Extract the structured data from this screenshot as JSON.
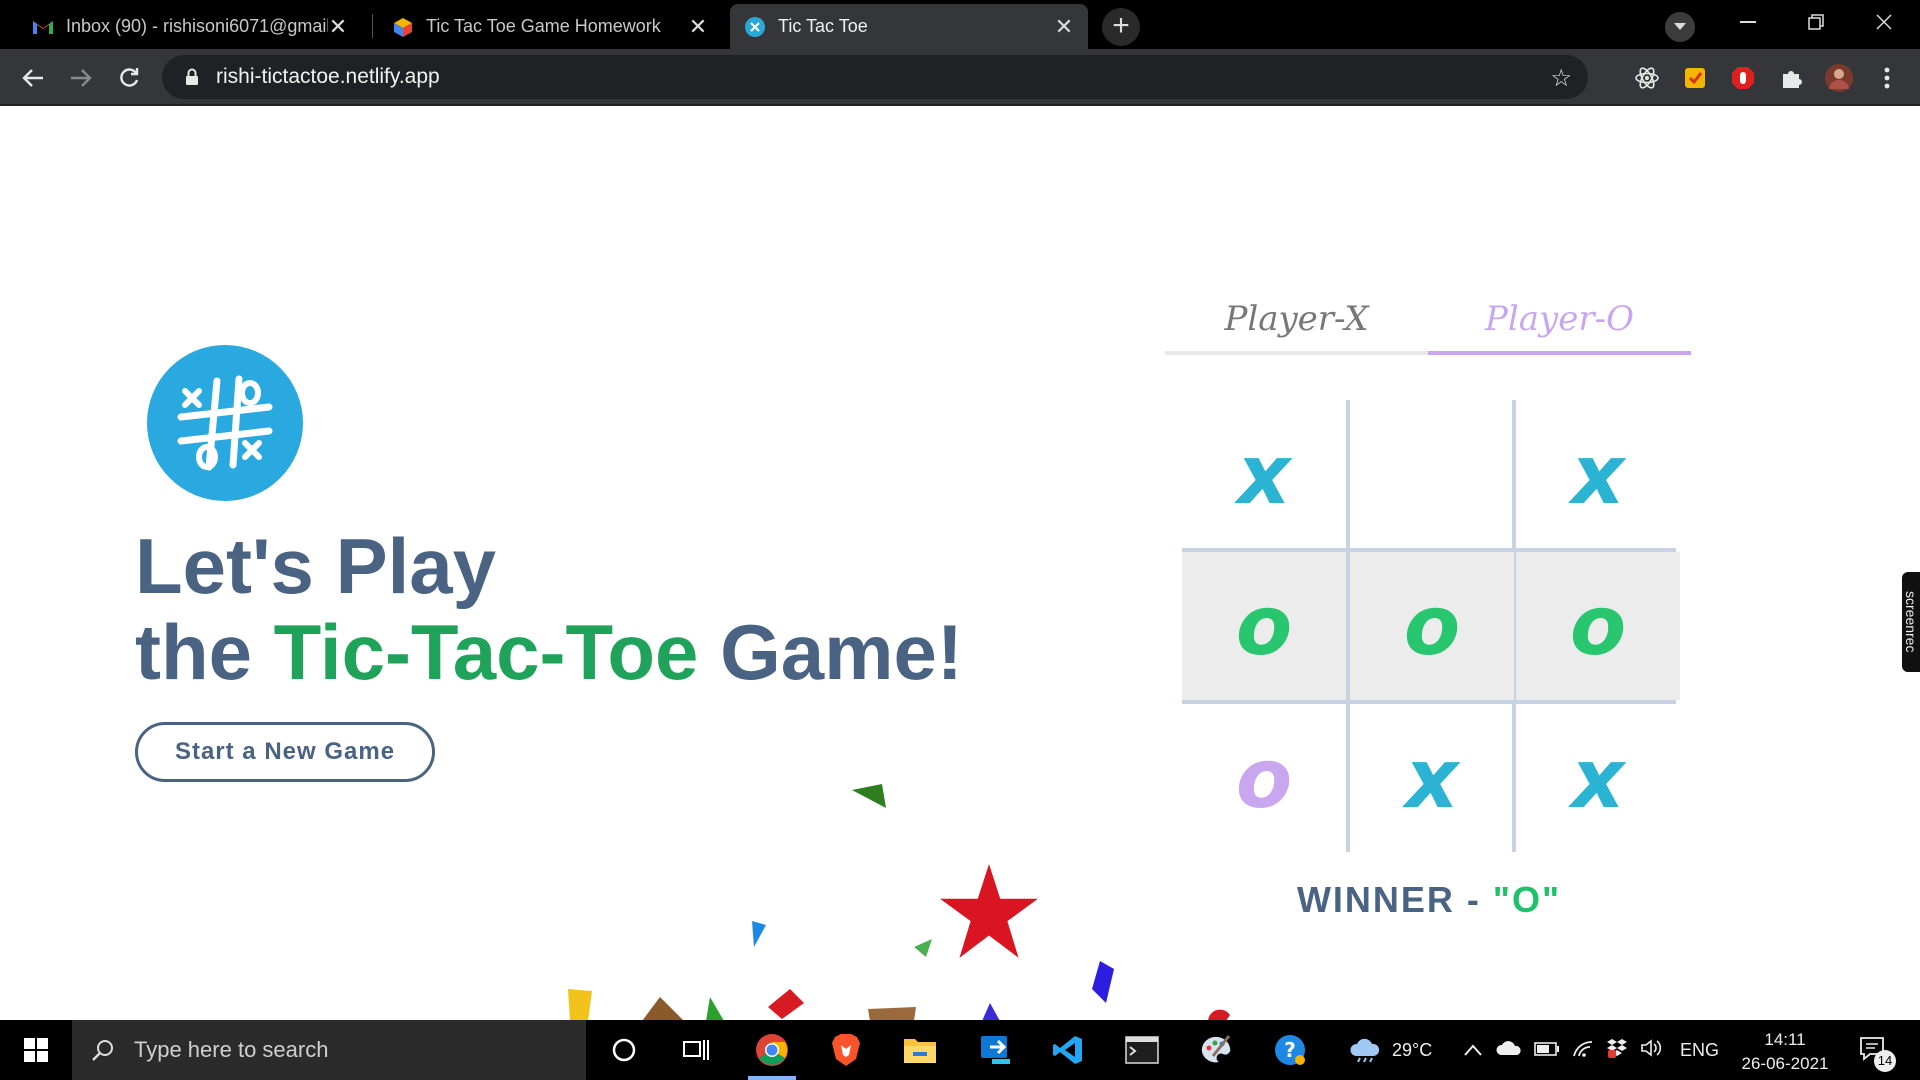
{
  "browser": {
    "tabs": [
      {
        "title": "Inbox (90) - rishisoni6071@gmail",
        "favicon": "gmail-icon",
        "active": false
      },
      {
        "title": "Tic Tac Toe Game Homework",
        "favicon": "cube-icon",
        "active": false
      },
      {
        "title": "Tic Tac Toe",
        "favicon": "netlify-icon",
        "active": true
      }
    ],
    "new_tab_symbol": "+",
    "close_symbol": "✕",
    "url": "rishi-tictactoe.netlify.app"
  },
  "page": {
    "headline_line1": "Let's Play",
    "headline_line2_prefix": "the ",
    "headline_line2_accent": "Tic-Tac-Toe",
    "headline_line2_suffix": " Game!",
    "start_button": "Start a New Game",
    "player_tabs": [
      "Player-X",
      "Player-O"
    ],
    "active_player": "Player-O",
    "board": [
      "X",
      "",
      "X",
      "O",
      "O",
      "O",
      "O",
      "X",
      "X"
    ],
    "winning_cells": [
      3,
      4,
      5
    ],
    "winner_label": "WINNER - ",
    "winner_value": "\"O\"",
    "side_widget": "screenrec"
  },
  "taskbar": {
    "search_placeholder": "Type here to search",
    "weather": "29°C",
    "language": "ENG",
    "time": "14:11",
    "date": "26-06-2021",
    "notifications": "14"
  },
  "colors": {
    "headline": "#4a6382",
    "accent_green": "#1fa35a",
    "x_mark": "#2bb3d4",
    "o_mark_win": "#28c76f",
    "o_mark": "#c9a7f0"
  }
}
